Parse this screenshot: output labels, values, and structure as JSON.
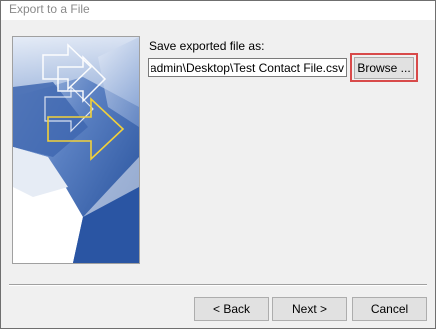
{
  "window": {
    "title": "Export to a File"
  },
  "form": {
    "save_label": "Save exported file as:",
    "file_path": "C:\\Users\\admin\\Desktop\\Test Contact File.csv",
    "browse_label": "Browse ..."
  },
  "footer": {
    "back_label": "< Back",
    "next_label": "Next >",
    "cancel_label": "Cancel"
  },
  "colors": {
    "highlight": "#d84a4a",
    "graphic_blue": "#2f5aa8",
    "arrow_yellow": "#f2d13a"
  },
  "icons": {
    "graphic": "export-wizard-graphic"
  }
}
